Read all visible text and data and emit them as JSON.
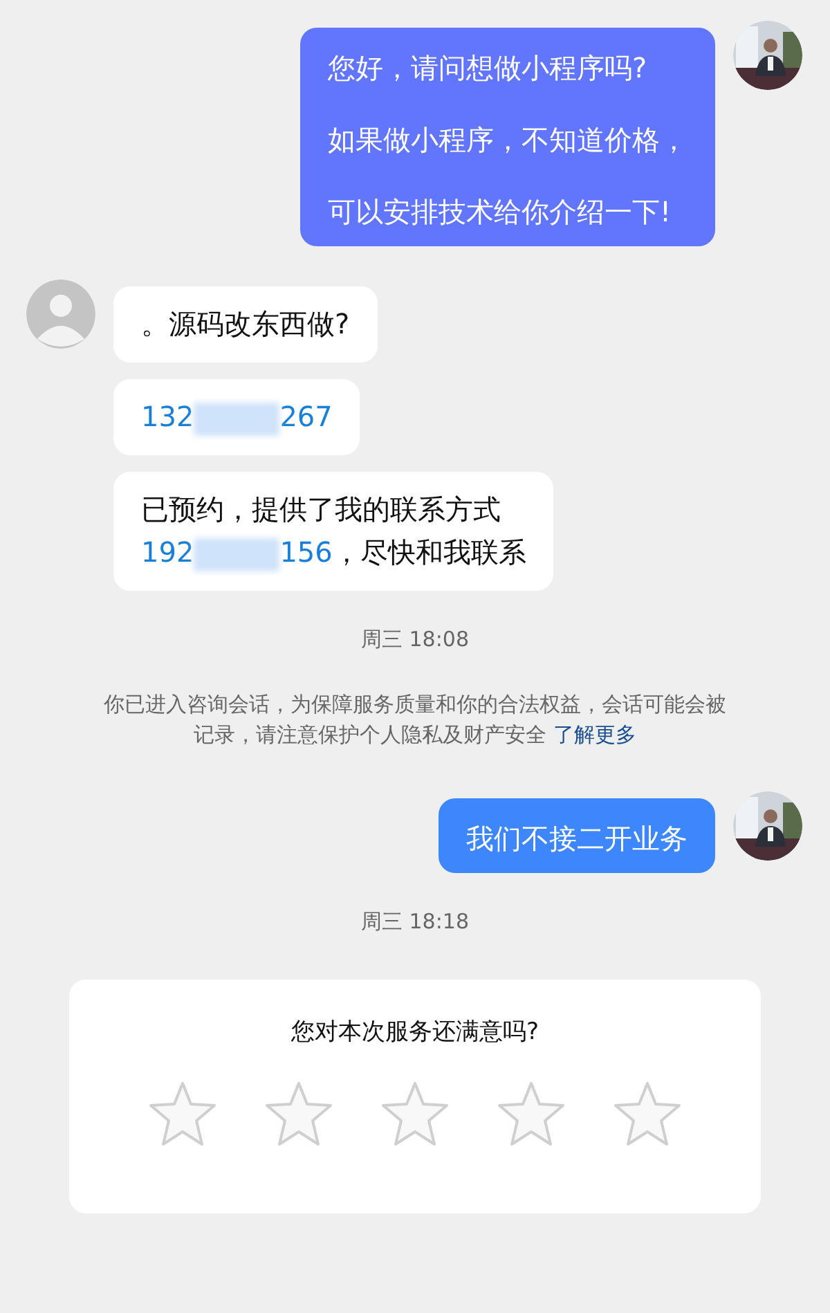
{
  "messages": [
    {
      "kind": "outgoing",
      "color": "#6175fd",
      "paragraphs": [
        "您好，请问想做小程序吗?",
        "如果做小程序，不知道价格，",
        "可以安排技术给你介绍一下!"
      ]
    },
    {
      "kind": "incoming",
      "paragraphs": [
        "。源码改东西做?"
      ]
    },
    {
      "kind": "phone",
      "parts": [
        {
          "text": "132",
          "kind": "link"
        },
        {
          "kind": "redacted"
        },
        {
          "text": "267",
          "kind": "link"
        }
      ]
    },
    {
      "kind": "phone",
      "parts": [
        {
          "text": "已预约，提供了我的联系方式",
          "kind": "plain"
        },
        {
          "kind": "break"
        },
        {
          "text": "192",
          "kind": "link"
        },
        {
          "kind": "redacted"
        },
        {
          "text": "156",
          "kind": "link"
        },
        {
          "text": "，尽快和我联系",
          "kind": "plain"
        }
      ]
    },
    {
      "kind": "time",
      "text": "周三 18:08"
    },
    {
      "kind": "notice",
      "text": "你已进入咨询会话，为保障服务质量和你的合法权益，会话可能会被记录，请注意保护个人隐私及财产安全",
      "link": "了解更多"
    },
    {
      "kind": "outgoing",
      "color": "#3d86fb",
      "paragraphs": [
        "我们不接二开业务"
      ]
    },
    {
      "kind": "time",
      "text": "周三 18:18"
    }
  ],
  "rating": {
    "question": "您对本次服务还满意吗?",
    "stars": 0
  }
}
